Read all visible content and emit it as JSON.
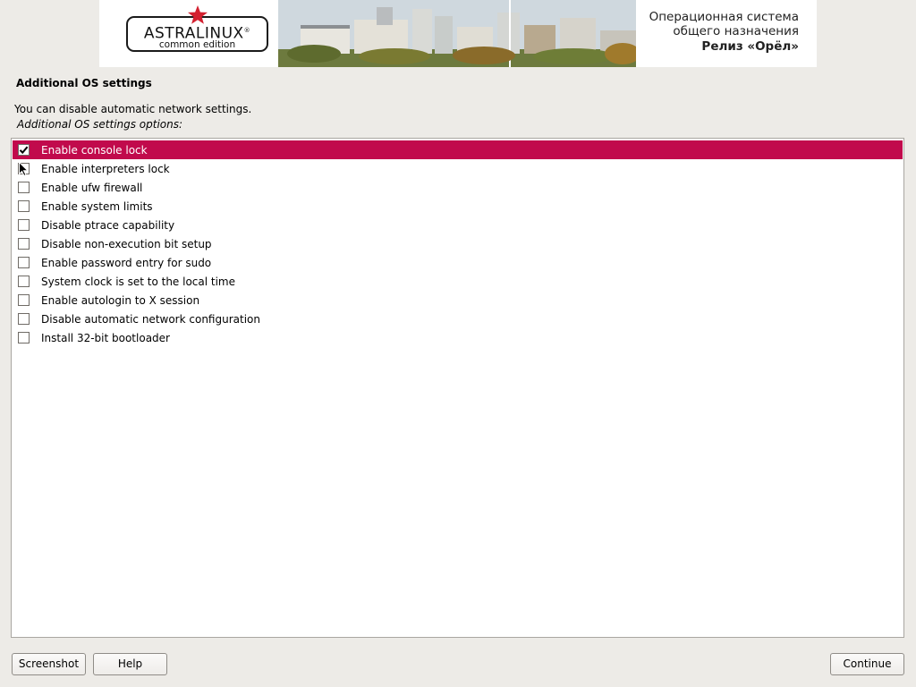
{
  "banner": {
    "logo_main": "ASTRALINUX",
    "logo_registered": "®",
    "logo_sub": "common edition",
    "line1": "Операционная система",
    "line2": "общего назначения",
    "release": "Релиз «Орёл»",
    "accent_color": "#d3202f"
  },
  "page": {
    "title": "Additional OS settings",
    "description": "You can disable automatic network settings.",
    "options_label": "Additional OS settings options:"
  },
  "options": [
    {
      "label": "Enable console lock",
      "checked": true,
      "selected": true
    },
    {
      "label": "Enable interpreters lock",
      "checked": false,
      "selected": false
    },
    {
      "label": "Enable ufw firewall",
      "checked": false,
      "selected": false
    },
    {
      "label": "Enable system limits",
      "checked": false,
      "selected": false
    },
    {
      "label": "Disable ptrace capability",
      "checked": false,
      "selected": false
    },
    {
      "label": "Disable non-execution bit setup",
      "checked": false,
      "selected": false
    },
    {
      "label": "Enable password entry for sudo",
      "checked": false,
      "selected": false
    },
    {
      "label": "System clock is set to the local time",
      "checked": false,
      "selected": false
    },
    {
      "label": "Enable autologin to X session",
      "checked": false,
      "selected": false
    },
    {
      "label": "Disable automatic network configuration",
      "checked": false,
      "selected": false
    },
    {
      "label": "Install 32-bit bootloader",
      "checked": false,
      "selected": false
    }
  ],
  "buttons": {
    "screenshot": "Screenshot",
    "help": "Help",
    "continue": "Continue"
  },
  "colors": {
    "selection": "#c10a4c",
    "background": "#edebe7"
  },
  "icons": {
    "logo_star": "red-star-icon",
    "check": "checkmark-icon",
    "cursor": "mouse-pointer-icon"
  }
}
